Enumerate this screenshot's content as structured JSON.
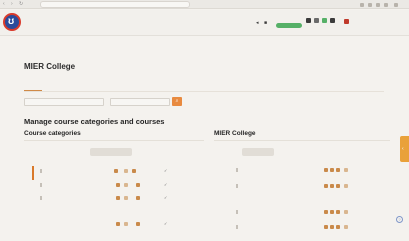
{
  "browser": {
    "back_icon": "back-arrow-icon",
    "forward_icon": "forward-arrow-icon",
    "reload_icon": "reload-icon",
    "url": "",
    "extension_icons": [
      "extension-icon",
      "extension-icon",
      "extension-icon",
      "extension-icon",
      "extension-icon"
    ]
  },
  "header": {
    "logo_icon": "moodle-logo-icon",
    "nav_items": [
      "",
      "",
      "",
      ""
    ],
    "edit_mode_label": "",
    "user_label": ""
  },
  "page": {
    "breadcrumb": "",
    "title": "MIER College",
    "tabs": [
      "",
      "",
      ""
    ],
    "tab2": "",
    "category_select": "",
    "search_placeholder": "",
    "search_button_icon": "search-icon",
    "manage_heading": "Manage course categories and courses",
    "left_column": {
      "heading": "Course categories",
      "action_pill": "",
      "rows": [
        {
          "name": "",
          "count": ""
        },
        {
          "name": "",
          "count": ""
        },
        {
          "name": "",
          "count": ""
        },
        {
          "name": "",
          "count": ""
        },
        {
          "name": "",
          "count": ""
        }
      ]
    },
    "right_column": {
      "heading": "MIER College",
      "action_pill": "",
      "side_text": "",
      "rows": [
        {
          "name": ""
        },
        {
          "name": ""
        },
        {
          "name": ""
        },
        {
          "name": ""
        }
      ]
    }
  },
  "colors": {
    "accent": "#e88a3f",
    "edit_toggle": "#56b067",
    "logo_blue": "#2b4b9b",
    "logo_red": "#d93a2b"
  }
}
